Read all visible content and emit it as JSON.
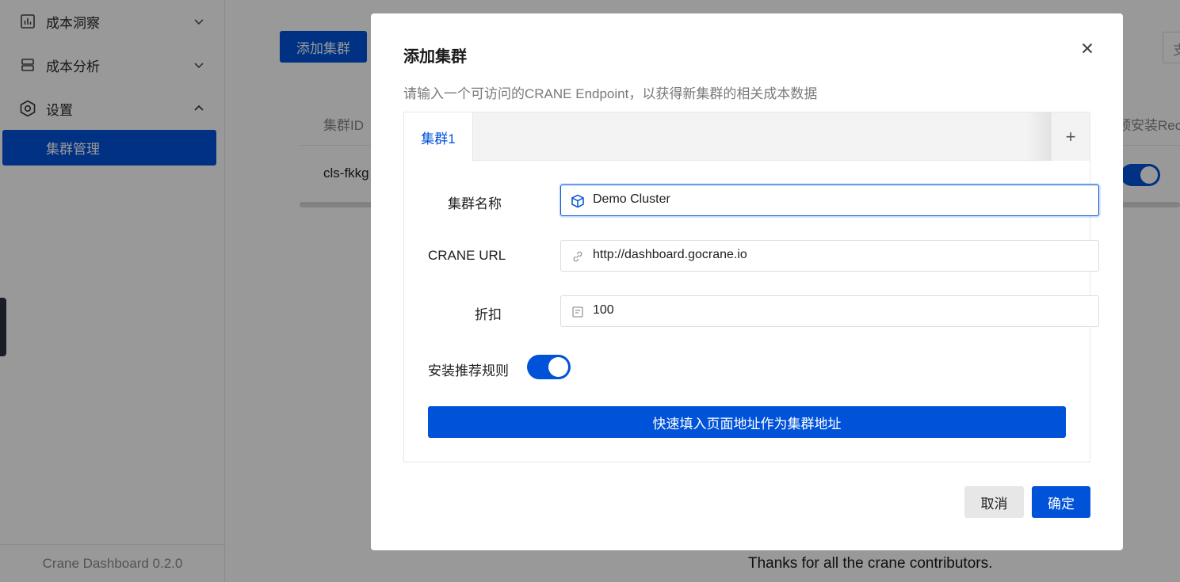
{
  "sidebar": {
    "items": [
      {
        "label": "成本洞察",
        "icon": "bar-chart-icon",
        "expanded": false
      },
      {
        "label": "成本分析",
        "icon": "layers-icon",
        "expanded": false
      },
      {
        "label": "设置",
        "icon": "gear-icon",
        "expanded": true
      }
    ],
    "active_sub_item": "集群管理",
    "footer": "Crane Dashboard 0.2.0"
  },
  "background": {
    "add_cluster_button": "添加集群",
    "table_header_cluster_id": "集群ID",
    "table_header_install": "预安装Rec",
    "table_cell_cluster_id": "cls-fkkg",
    "search_placeholder": "支",
    "footer_text": "Thanks for all the crane contributors."
  },
  "dialog": {
    "title": "添加集群",
    "description": "请输入一个可访问的CRANE Endpoint，以获得新集群的相关成本数据",
    "tabs": [
      {
        "label": "集群1"
      }
    ],
    "add_tab": "+",
    "form": {
      "cluster_name": {
        "label": "集群名称",
        "value": "Demo Cluster",
        "icon": "cube-icon"
      },
      "crane_url": {
        "label": "CRANE URL",
        "value": "http://dashboard.gocrane.io",
        "icon": "link-icon"
      },
      "discount": {
        "label": "折扣",
        "value": "100",
        "icon": "document-icon"
      },
      "install_rules": {
        "label": "安装推荐规则",
        "enabled": true
      }
    },
    "quick_fill_button": "快速填入页面地址作为集群地址",
    "cancel_button": "取消",
    "confirm_button": "确定"
  },
  "colors": {
    "primary": "#0052d9",
    "overlay": "rgba(0,0,0,0.40)"
  }
}
